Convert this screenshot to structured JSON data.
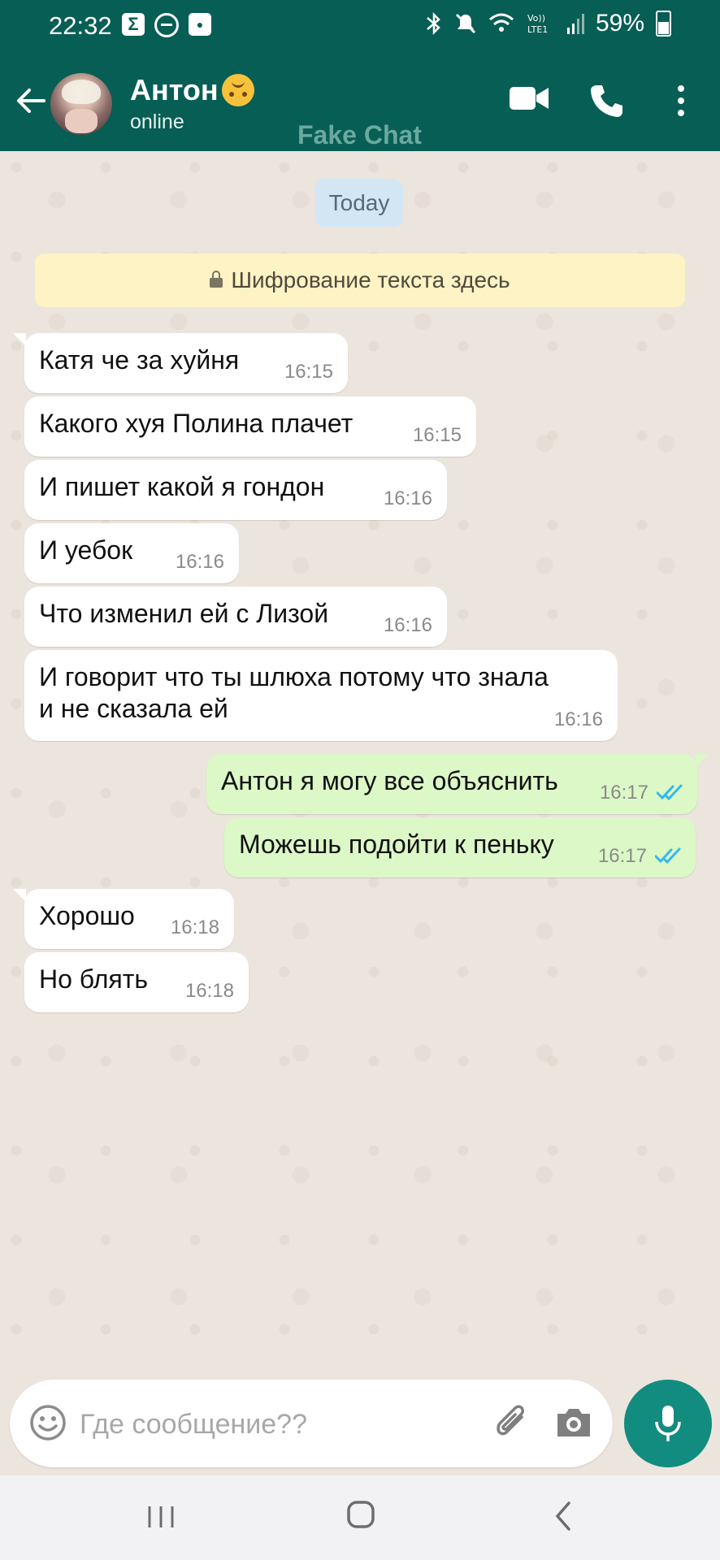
{
  "status_bar": {
    "time": "22:32",
    "sigma_label": "Σ",
    "battery": "59%"
  },
  "header": {
    "contact_name": "Антон",
    "contact_status": "online",
    "watermark": "Fake Chat"
  },
  "chat": {
    "date_label": "Today",
    "encryption_notice": "Шифрование текста здесь",
    "messages": [
      {
        "dir": "in",
        "text": "Катя че за хуйня",
        "time": "16:15"
      },
      {
        "dir": "in",
        "text": "Какого хуя Полина плачет",
        "time": "16:15"
      },
      {
        "dir": "in",
        "text": "И пишет какой я гондон",
        "time": "16:16"
      },
      {
        "dir": "in",
        "text": "И уебок",
        "time": "16:16"
      },
      {
        "dir": "in",
        "text": "Что изменил ей с Лизой",
        "time": "16:16"
      },
      {
        "dir": "in",
        "text": "И говорит что ты шлюха потому что знала",
        "text2": "и не сказала ей",
        "time": "16:16"
      },
      {
        "dir": "out",
        "text": "Антон я могу все объяснить",
        "time": "16:17",
        "status": "read"
      },
      {
        "dir": "out",
        "text": "Можешь подойти к пеньку",
        "time": "16:17",
        "status": "read"
      },
      {
        "dir": "in",
        "text": "Хорошо",
        "time": "16:18"
      },
      {
        "dir": "in",
        "text": "Но блять",
        "time": "16:18"
      }
    ]
  },
  "composer": {
    "placeholder": "Где сообщение??"
  },
  "colors": {
    "header_bg": "#075e54",
    "incoming_bubble": "#ffffff",
    "outgoing_bubble": "#dcf8c6",
    "read_tick": "#34b7f1",
    "mic_button": "#128c7e"
  },
  "icons": [
    "back-arrow",
    "video-call",
    "phone",
    "more-vert",
    "lock",
    "emoji",
    "paperclip",
    "camera",
    "microphone",
    "recent-apps",
    "home",
    "back"
  ]
}
